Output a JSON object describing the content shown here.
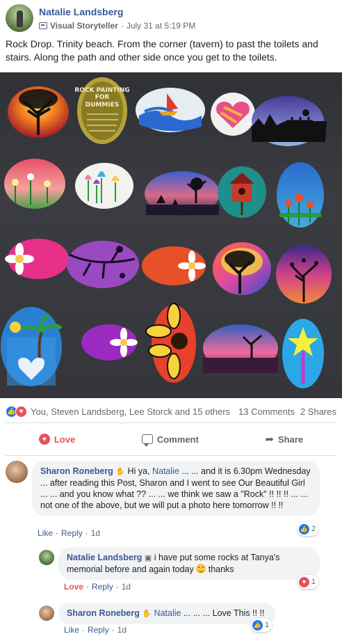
{
  "post": {
    "author": "Natalie Landsberg",
    "badge_label": "Visual Storyteller",
    "badge_icon": "storyteller-icon",
    "separator": "·",
    "timestamp": "July 31 at 5:19 PM",
    "text": "Rock Drop. Trinity beach. From the corner (tavern) to past the toilets and stairs. Along the path and other side once you get to the toilets."
  },
  "reactions": {
    "icons": [
      "like-icon",
      "love-icon"
    ],
    "reactors": "You, Steven Landsberg, Lee Storck and 15 others",
    "comments_count": "13 Comments",
    "shares_count": "2 Shares"
  },
  "actions": {
    "love_label": "Love",
    "comment_label": "Comment",
    "share_label": "Share"
  },
  "comments": [
    {
      "author": "Sharon Roneberg",
      "greeting": "Hi ya, ",
      "mention": "Natalie",
      "text": " ... ... and it is 6.30pm Wednesday ... after reading this Post, Sharon and I went to see Our Beautiful Girl ... ... and you know what ?? ... ... we think we saw a \"Rock\" !! !! !! ... ... not one of the above, but we will put a photo here tomorrow !! !!",
      "like_label": "Like",
      "reply_label": "Reply",
      "time": "1d",
      "reaction_count": "2"
    },
    {
      "author": "Natalie Landsberg",
      "text": "i have put some rocks at Tanya's memorial before and again today",
      "text_after": " thanks",
      "love_label": "Love",
      "reply_label": "Reply",
      "time": "1d",
      "reaction_count": "1"
    },
    {
      "author": "Sharon Roneberg",
      "mention": "Natalie",
      "text": " ... ... ... Love This !! !!",
      "like_label": "Like",
      "reply_label": "Reply",
      "time": "1d",
      "reaction_count": "1"
    }
  ],
  "colors": {
    "link_blue": "#385898",
    "like_blue": "#1877f2",
    "love_red": "#e8505b",
    "bubble_gray": "#f2f3f5",
    "meta_gray": "#606770"
  }
}
